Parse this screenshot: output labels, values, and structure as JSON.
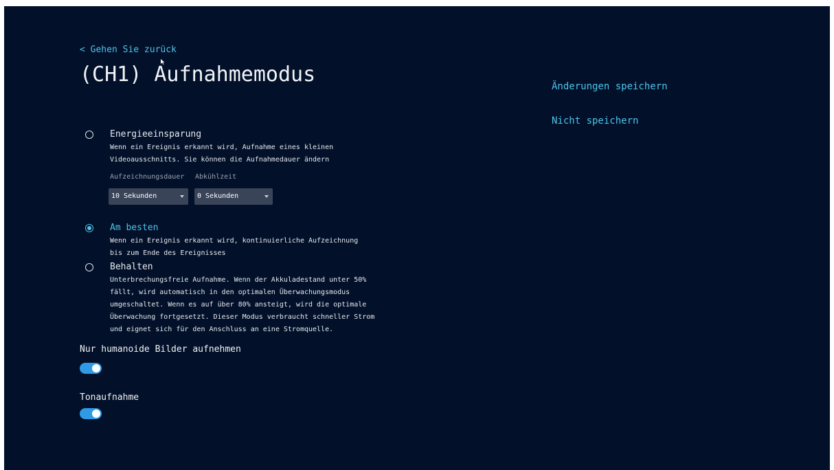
{
  "header": {
    "back_label": "< Gehen Sie zurück",
    "title": "(CH1) Aufnahmemodus"
  },
  "actions": {
    "save_label": "Änderungen speichern",
    "discard_label": "Nicht speichern"
  },
  "modes": [
    {
      "title": "Energieeinsparung",
      "desc_lines": [
        "Wenn ein Ereignis erkannt wird, Aufnahme eines kleinen",
        "Videoausschnitts. Sie können die Aufnahmedauer ändern"
      ],
      "selected": false
    },
    {
      "title": "Am besten",
      "desc_lines": [
        "Wenn ein Ereignis erkannt wird, kontinuierliche Aufzeichnung",
        "bis zum Ende des Ereignisses"
      ],
      "selected": true
    },
    {
      "title": "Behalten",
      "desc_lines": [
        "Unterbrechungsfreie Aufnahme. Wenn der Akkuladestand unter 50%",
        "fällt, wird automatisch in den optimalen Überwachungsmodus",
        "umgeschaltet. Wenn es auf über 80% ansteigt, wird die optimale",
        "Überwachung fortgesetzt. Dieser Modus verbraucht schneller Strom",
        "und eignet sich für den Anschluss an eine Stromquelle."
      ],
      "selected": false
    }
  ],
  "energy_settings": {
    "duration_label": "Aufzeichnungsdauer",
    "duration_value": "10 Sekunden",
    "cooldown_label": "Abkühlzeit",
    "cooldown_value": "0 Sekunden"
  },
  "toggles": [
    {
      "label": "Nur humanoide Bilder aufnehmen",
      "on": true
    },
    {
      "label": "Tonaufnahme",
      "on": true
    }
  ],
  "colors": {
    "background": "#02102a",
    "accent": "#4fc3e8",
    "toggle_on": "#2f9be6",
    "select_bg": "#3a4458"
  }
}
